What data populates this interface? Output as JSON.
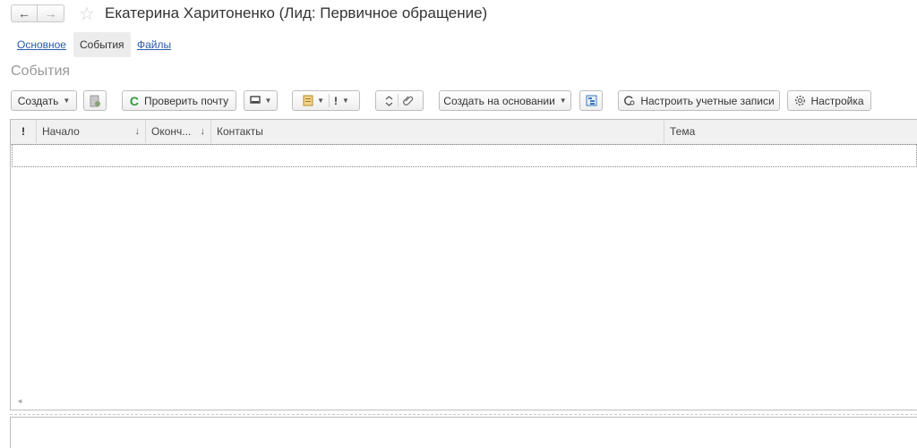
{
  "header": {
    "back_icon": "←",
    "forward_icon": "→",
    "star_icon": "☆",
    "title": "Екатерина Харитоненко (Лид: Первичное обращение)"
  },
  "tabs": [
    {
      "label": "Основное"
    },
    {
      "label": "События"
    },
    {
      "label": "Файлы"
    }
  ],
  "section_title": "События",
  "toolbar": {
    "create_label": "Создать",
    "check_mail_label": "Проверить почту",
    "check_mail_icon": "C",
    "priority_icon": "!",
    "create_based_label": "Создать на основании",
    "configure_accounts_label": "Настроить учетные записи",
    "settings_label": "Настройка"
  },
  "table": {
    "columns": [
      {
        "label": "!"
      },
      {
        "label": "Начало",
        "sort": "↓"
      },
      {
        "label": "Оконч...",
        "sort": "↓"
      },
      {
        "label": "Контакты"
      },
      {
        "label": "Тема"
      }
    ],
    "rows": []
  },
  "colors": {
    "link": "#2a5aa8",
    "check_mail_icon": "#2e9a3a",
    "muted_title": "#999999"
  }
}
